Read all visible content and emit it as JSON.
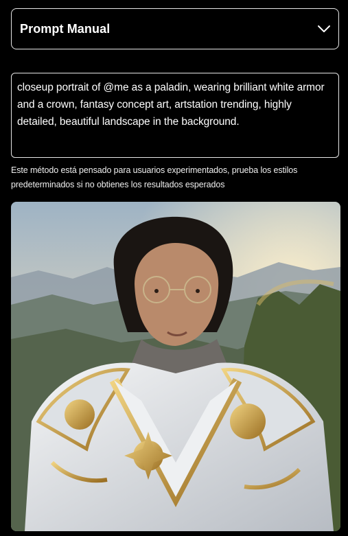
{
  "dropdown": {
    "label": "Prompt Manual",
    "icon": "chevron-down-icon"
  },
  "prompt": {
    "value": "closeup portrait of @me as a paladin, wearing brilliant white armor and a crown, fantasy concept art, artstation trending, highly detailed, beautiful landscape in the background."
  },
  "hint": {
    "text": "Este método está pensado para usuarios experimentados, prueba los estilos predeterminados si no obtienes los resultados esperados"
  },
  "result_image": {
    "description": "generated-portrait-paladin"
  },
  "colors": {
    "background": "#000000",
    "border": "#e8e8e8",
    "text": "#ffffff",
    "armor_gold": "#c9a24a",
    "armor_white": "#e9ecef"
  }
}
